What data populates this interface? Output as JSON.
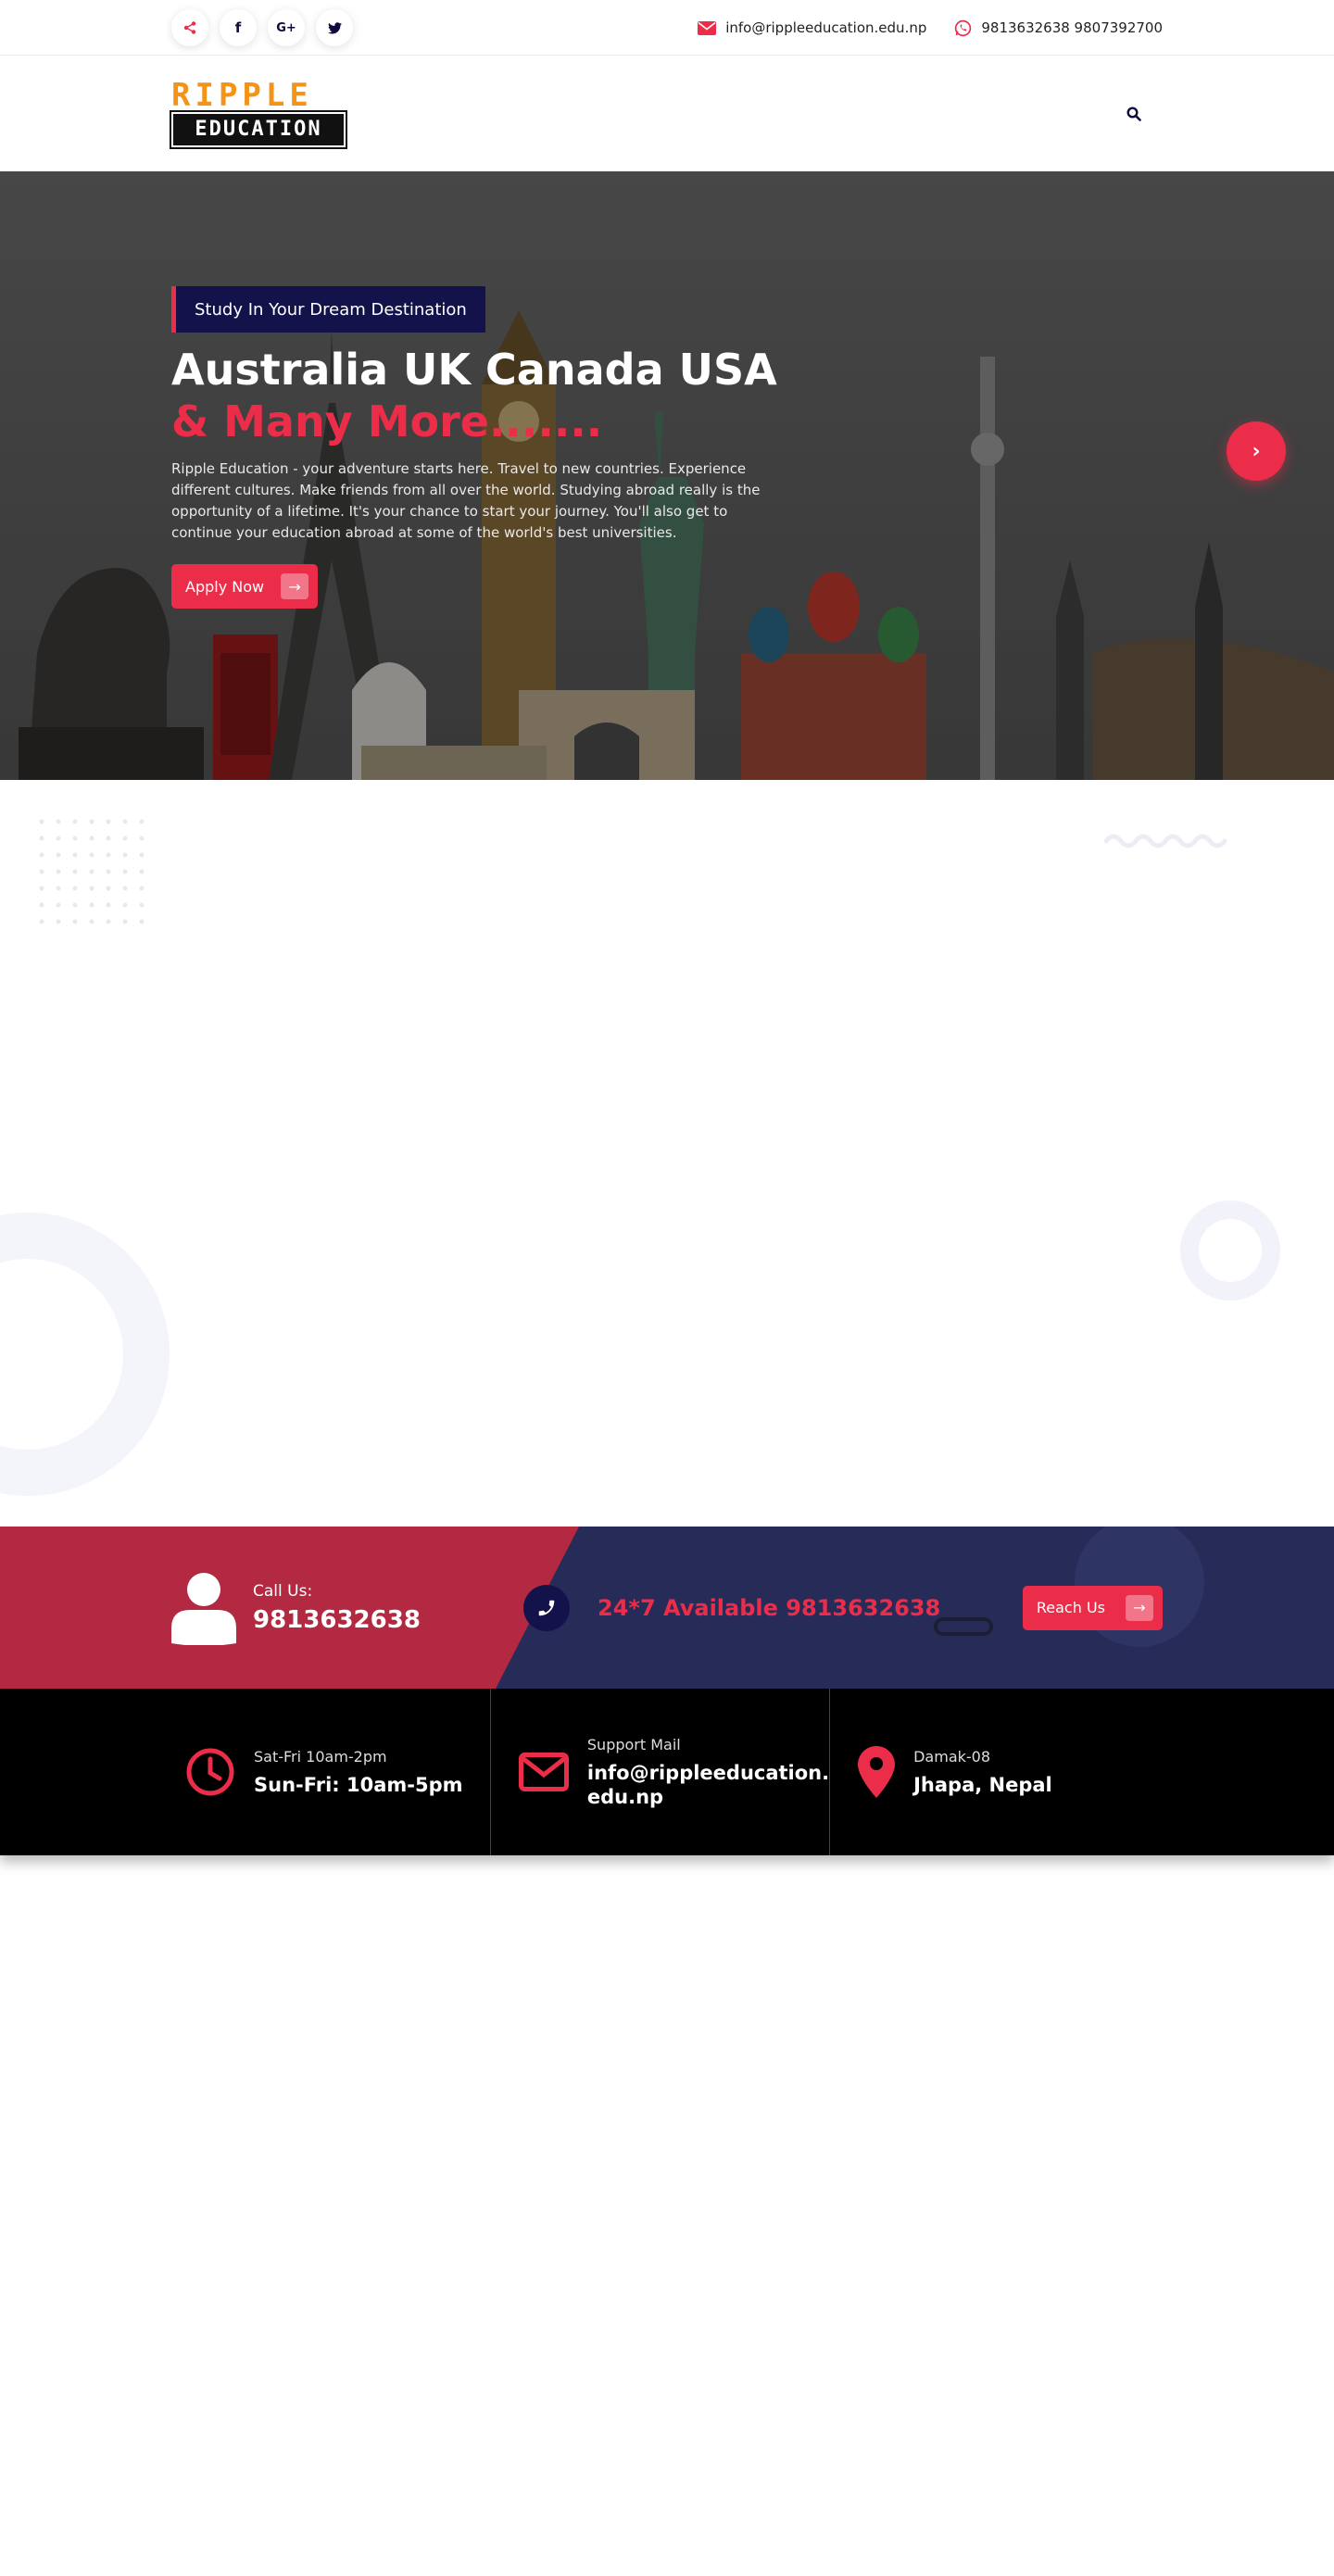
{
  "topbar": {
    "socials": [
      {
        "icon": "share-icon",
        "glyph": "⋖"
      },
      {
        "icon": "facebook-icon",
        "glyph": "f"
      },
      {
        "icon": "google-plus-icon",
        "glyph": "G+"
      },
      {
        "icon": "twitter-icon",
        "glyph": "t"
      }
    ],
    "email": "info@rippleeducation.edu.np",
    "phone": "9813632638 9807392700"
  },
  "header": {
    "logo_top": "RIPPLE",
    "logo_bottom": "EDUCATION"
  },
  "hero": {
    "badge": "Study In Your Dream Destination",
    "title_line1": "Australia UK Canada USA",
    "title_line2": "& Many More.......",
    "text": "Ripple Education - your adventure starts here. Travel to new countries. Experience different cultures. Make friends from all over the world. Studying abroad really is the opportunity of a lifetime. It's your chance to start your journey. You'll also get to continue your education abroad at some of the world's best universities.",
    "apply_label": "Apply Now"
  },
  "cta": {
    "call_label": "Call Us:",
    "call_number": "9813632638",
    "available": "24*7 Available 9813632638",
    "reach_label": "Reach Us"
  },
  "info": {
    "hours_small": "Sat-Fri 10am-2pm",
    "hours_big": "Sun-Fri: 10am-5pm",
    "mail_small": "Support Mail",
    "mail_big": "info@rippleeducation.\nedu.np",
    "loc_small": "Damak-08",
    "loc_big": "Jhapa, Nepal"
  },
  "colors": {
    "accent": "#ec2d4a",
    "navy": "#14124a",
    "logo_orange": "#f39418"
  }
}
